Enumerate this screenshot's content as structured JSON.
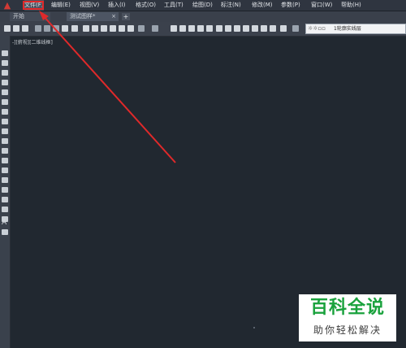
{
  "menubar": {
    "items": [
      {
        "label": "文件(F)"
      },
      {
        "label": "编辑(E)"
      },
      {
        "label": "视图(V)"
      },
      {
        "label": "插入(I)"
      },
      {
        "label": "格式(O)"
      },
      {
        "label": "工具(T)"
      },
      {
        "label": "绘图(D)"
      },
      {
        "label": "标注(N)"
      },
      {
        "label": "修改(M)"
      },
      {
        "label": "参数(P)"
      },
      {
        "label": "窗口(W)"
      },
      {
        "label": "帮助(H)"
      }
    ]
  },
  "tabs": {
    "start": "开始",
    "drawing": "测试图样*",
    "close": "×",
    "add": "+"
  },
  "layer": {
    "name": "1轮廓实线层"
  },
  "viewport": {
    "label": "-][俯视][二维线框]"
  },
  "left_toolbar": {
    "text_tool": "A"
  },
  "watermark": {
    "title": "百科全说",
    "subtitle": "助你轻松解决"
  },
  "annotation": {
    "color": "#e0292a"
  }
}
